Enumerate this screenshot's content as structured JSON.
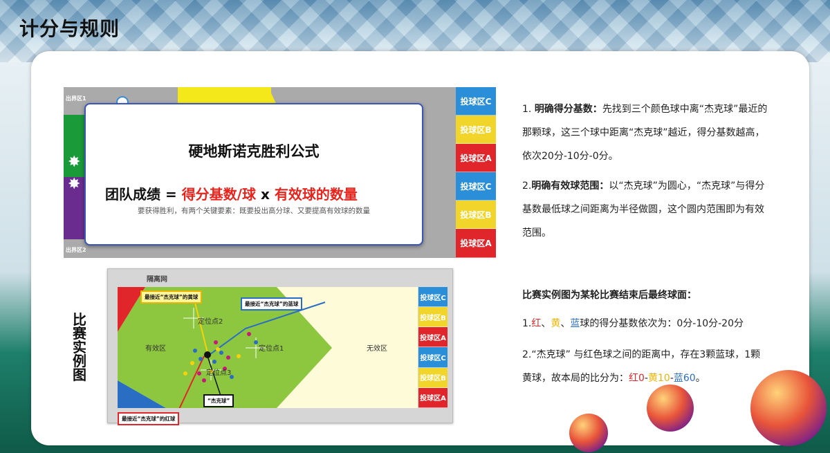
{
  "page": {
    "title": "计分与规则"
  },
  "top_image": {
    "formula_title": "硬地斯诺克胜利公式",
    "formula_left": "团队成绩 = ",
    "formula_red": "得分基数/球",
    "formula_mid": " x ",
    "formula_red2": "有效球的数量",
    "formula_sub": "要获得胜利，有两个关键要素：既要投出高分球、又要提高有效球的数量",
    "out_zone_1": "出界区1",
    "out_zone_2": "出界区2",
    "zones": [
      "投球区C",
      "投球区B",
      "投球区A",
      "投球区C",
      "投球区B",
      "投球区A"
    ]
  },
  "bottom_image": {
    "side_label": "比赛实例图",
    "net_label": "隔离网",
    "valid_zone": "有效区",
    "invalid_zone": "无效区",
    "pos1": "定位点1",
    "pos2": "定位点2",
    "pos3": "定位点3",
    "callout_yellow": "最接近“杰克球”的黄球",
    "callout_blue": "最接近“杰克球”的蓝球",
    "callout_jack": "“杰克球”",
    "callout_red": "最接近“杰克球”的红球",
    "zones": [
      "投球区C",
      "投球区B",
      "投球区A",
      "投球区C",
      "投球区B",
      "投球区A"
    ]
  },
  "rules": {
    "r1_head": "1. ",
    "r1_bold": "明确得分基数：",
    "r1_text": "先找到三个颜色球中离“杰克球”最近的那颗球，这三个球中距离“杰克球”越近，得分基数越高，依次20分-10分-0分。",
    "r2_head": "2.",
    "r2_bold": "明确有效球范围：",
    "r2_text": "以“杰克球”为圆心，“杰克球”与得分基数最低球之间距离为半径做圆，这个圆内范围即为有效范围。",
    "example_title": "比赛实例图为某轮比赛结束后最终球面：",
    "e1_prefix": "1.",
    "e1_red": "红",
    "e1_sep1": "、",
    "e1_yellow": "黄",
    "e1_sep2": "、",
    "e1_blue": "蓝",
    "e1_text": "球的得分基数依次为：0分-10分-20分",
    "e2_text": "2.“杰克球” 与红色球之间的距离中，存在3颗蓝球，1颗黄球，故本局的比分为：",
    "e2_red": "红0",
    "e2_sep1": "-",
    "e2_yellow": "黄10",
    "e2_sep2": "-",
    "e2_blue": "蓝60",
    "e2_end": "。"
  },
  "colors": {
    "red": "#e0262a",
    "yellow": "#e8b500",
    "blue": "#2a6ec4",
    "green": "#8dc63f"
  }
}
